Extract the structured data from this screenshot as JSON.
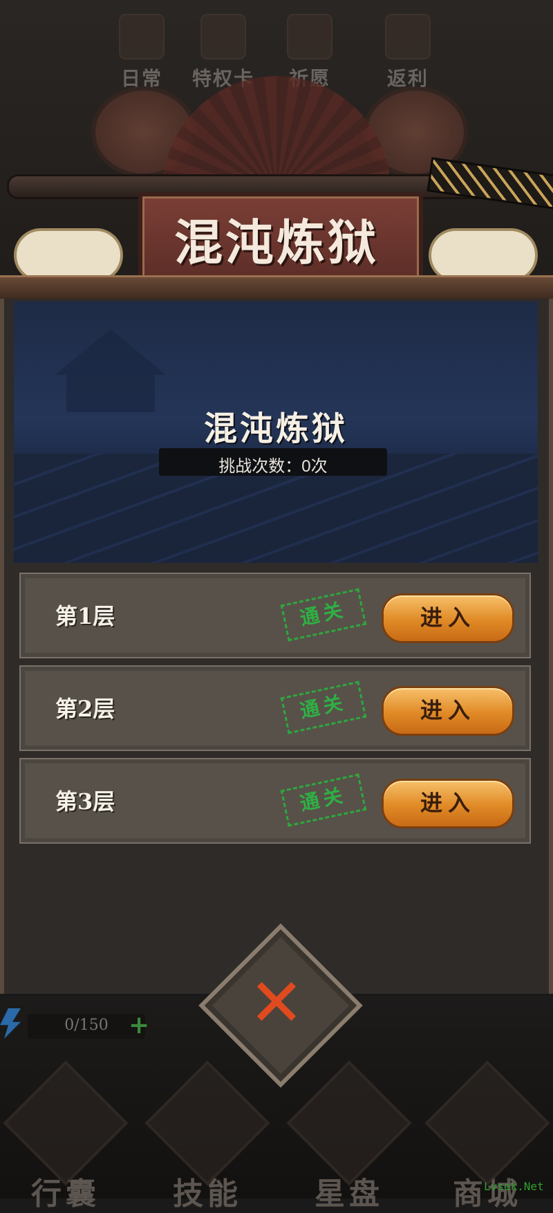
{
  "top_tabs": [
    {
      "label": "日常",
      "icon": "scroll-icon"
    },
    {
      "label": "特权卡",
      "icon": "card-icon"
    },
    {
      "label": "祈愿",
      "icon": "shrine-icon"
    },
    {
      "label": "返利",
      "icon": "treasure-chest-icon"
    }
  ],
  "banner": {
    "title": "混沌炼狱"
  },
  "stage": {
    "title": "混沌炼狱",
    "challenge_count": "挑战次数：0次"
  },
  "floors": [
    {
      "label": "第1层",
      "status": "通关",
      "button": "进入"
    },
    {
      "label": "第2层",
      "status": "通关",
      "button": "进入"
    },
    {
      "label": "第3层",
      "status": "通关",
      "button": "进入"
    }
  ],
  "close_button": {
    "glyph": "✕"
  },
  "energy": {
    "text": "0/150",
    "plus": "+"
  },
  "bottom_nav": [
    {
      "label": "行囊"
    },
    {
      "label": "技能"
    },
    {
      "label": "星盘"
    },
    {
      "label": "商城"
    }
  ],
  "watermark": "Lvsek.Net",
  "colors": {
    "stamp_green": "#2fb043",
    "button_orange": "#e08a26",
    "close_red": "#e04a1e"
  }
}
